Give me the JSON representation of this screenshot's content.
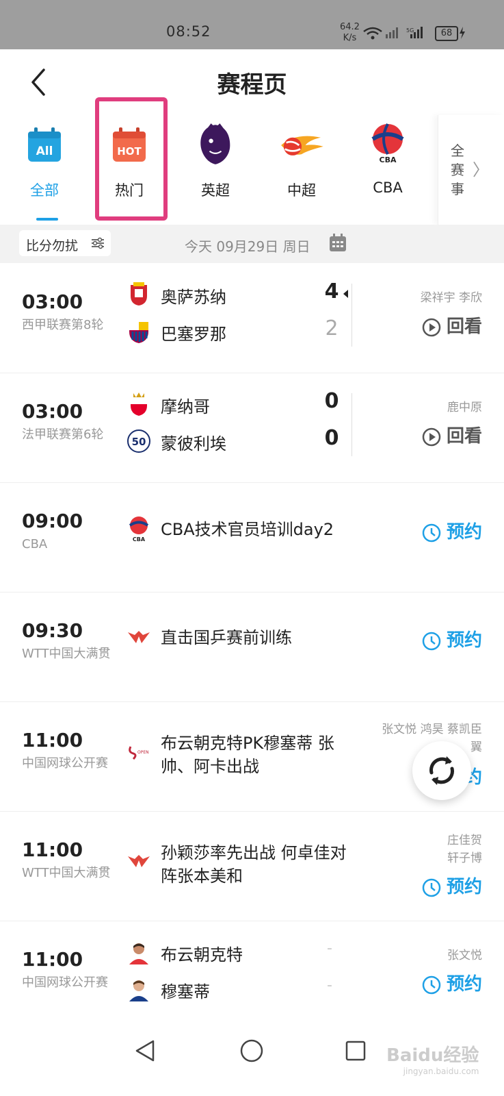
{
  "status_bar": {
    "time": "08:52",
    "net_speed_value": "64.2",
    "net_speed_unit": "K/s",
    "battery": "68"
  },
  "header": {
    "title": "赛程页"
  },
  "categories": [
    {
      "label": "全部",
      "icon": "all-calendar-icon",
      "active": true,
      "icon_text": "All"
    },
    {
      "label": "热门",
      "icon": "hot-calendar-icon",
      "active": false,
      "icon_text": "HOT"
    },
    {
      "label": "英超",
      "icon": "premier-league-lion-icon",
      "active": false
    },
    {
      "label": "中超",
      "icon": "csl-fireball-icon",
      "active": false
    },
    {
      "label": "CBA",
      "icon": "cba-basketball-icon",
      "active": false
    }
  ],
  "more_categories": {
    "label": "全赛事"
  },
  "filter": {
    "mute_score_label": "比分勿扰",
    "date_label": "今天 09月29日 周日"
  },
  "matches": [
    {
      "time": "03:00",
      "league": "西甲联赛第8轮",
      "home": "奥萨苏纳",
      "away": "巴塞罗那",
      "home_score": "4",
      "away_score": "2",
      "commentators": "梁祥宇 李欣",
      "action": "回看"
    },
    {
      "time": "03:00",
      "league": "法甲联赛第6轮",
      "home": "摩纳哥",
      "away": "蒙彼利埃",
      "home_score": "0",
      "away_score": "0",
      "commentators": "鹿中原",
      "action": "回看"
    },
    {
      "time": "09:00",
      "league": "CBA",
      "title": "CBA技术官员培训day2",
      "action": "预约"
    },
    {
      "time": "09:30",
      "league": "WTT中国大满贯",
      "title": "直击国乒赛前训练",
      "action": "预约"
    },
    {
      "time": "11:00",
      "league": "中国网球公开赛",
      "title": "布云朝克特PK穆塞蒂 张帅、阿卡出战",
      "commentators_line1": "张文悦 鸿昊 蔡凯臣",
      "commentators_line2": "翼",
      "action": "约"
    },
    {
      "time": "11:00",
      "league": "WTT中国大满贯",
      "title": "孙颖莎率先出战 何卓佳对阵张本美和",
      "commentators_line1": "庄佳贺",
      "commentators_line2": "轩子博",
      "action": "预约"
    },
    {
      "time": "11:00",
      "league": "中国网球公开赛",
      "home": "布云朝克特",
      "away": "穆塞蒂",
      "home_score": "-",
      "away_score": "-",
      "commentators": "张文悦",
      "action": "预约"
    }
  ],
  "watermark": {
    "brand": "Baidu经验",
    "sub": "jingyan.baidu.com"
  },
  "colors": {
    "accent": "#1ea0e6",
    "highlight": "#e03d7e"
  }
}
